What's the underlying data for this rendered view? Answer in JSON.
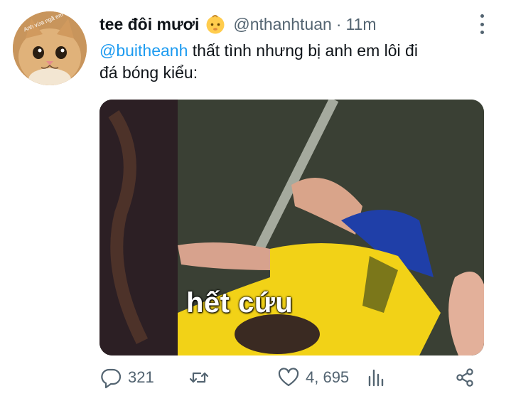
{
  "tweet": {
    "display_name": "tee đôi mươi",
    "display_name_emoji": "baby-face-emoji",
    "handle": "@nthanhtuan",
    "separator": "·",
    "time": "11m",
    "avatar_text": "Anh vừa ngã em hả",
    "mention": "@buitheanh",
    "text_line1": " thất tình nhưng bị anh em lôi đi",
    "text_line2": "đá bóng kiểu:",
    "media_caption": "hết cứu",
    "stats": {
      "replies": "321",
      "likes": "4, 695"
    }
  },
  "icons": {
    "more": "more-vertical-icon",
    "reply": "reply-icon",
    "retweet": "retweet-icon",
    "like": "heart-icon",
    "views": "analytics-icon",
    "share": "share-icon"
  },
  "colors": {
    "text": "#0f1419",
    "secondary": "#536471",
    "link": "#1d9bf0"
  }
}
